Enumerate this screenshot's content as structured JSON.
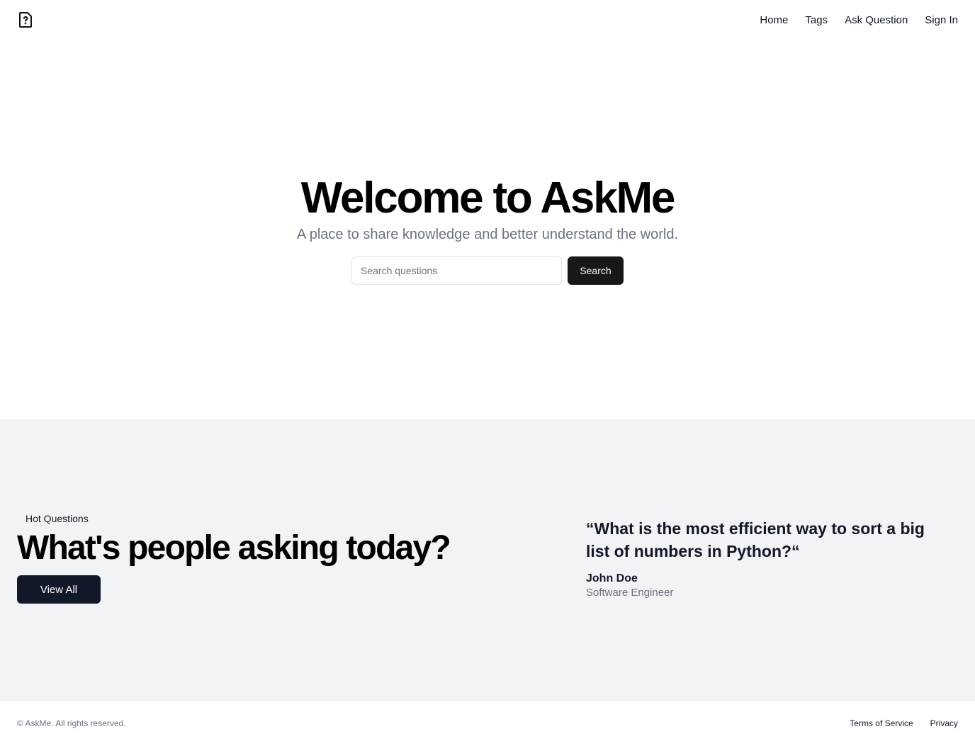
{
  "header": {
    "logo_icon": "file-question-icon",
    "nav": [
      {
        "label": "Home"
      },
      {
        "label": "Tags"
      },
      {
        "label": "Ask Question"
      },
      {
        "label": "Sign In"
      }
    ]
  },
  "hero": {
    "title": "Welcome to AskMe",
    "subtitle": "A place to share knowledge and better understand the world.",
    "search_placeholder": "Search questions",
    "search_value": "",
    "search_button": "Search"
  },
  "hot": {
    "badge": "Hot Questions",
    "title": "What's people asking today?",
    "view_all": "View All",
    "quote": "“What is the most efficient way to sort a big list of numbers in Python?“",
    "author": "John Doe",
    "role": "Software Engineer"
  },
  "footer": {
    "copyright": "© AskMe. All rights reserved.",
    "links": [
      {
        "label": "Terms of Service"
      },
      {
        "label": "Privacy"
      }
    ]
  },
  "colors": {
    "section_bg": "#f2f3f5",
    "primary_button": "#18181b",
    "view_button": "#111827",
    "muted_text": "#6b7280"
  }
}
